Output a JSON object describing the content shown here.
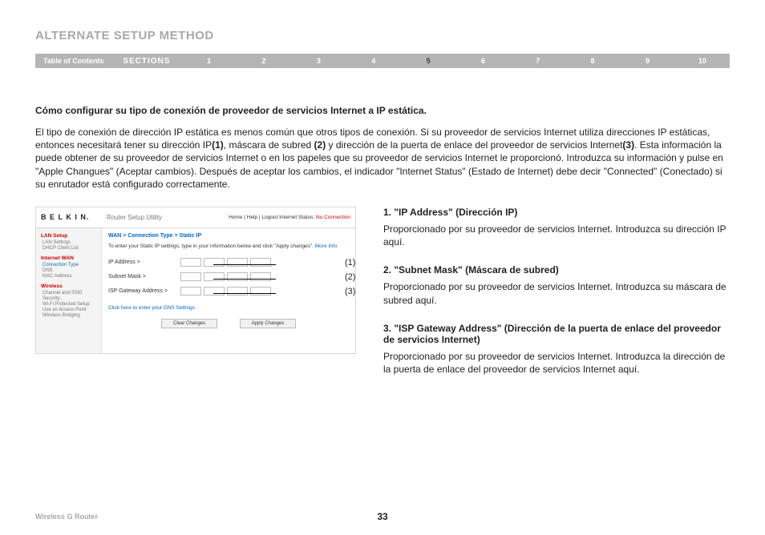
{
  "page": {
    "title": "ALTERNATE SETUP METHOD",
    "product": "Wireless G Router",
    "number": "33"
  },
  "nav": {
    "toc": "Table of Contents",
    "sections": "SECTIONS",
    "items": [
      "1",
      "2",
      "3",
      "4",
      "5",
      "6",
      "7",
      "8",
      "9",
      "10"
    ],
    "active": "5"
  },
  "intro": {
    "heading": "Cómo configurar su tipo de conexión de proveedor de servicios Internet a IP estática.",
    "paragraph_pre": "El tipo de conexión de dirección IP estática es menos común que otros tipos de conexión. Si su proveedor de servicios Internet utiliza direcciones IP estáticas, entonces necesitará tener su dirección IP",
    "m1": "(1)",
    "paragraph_mid1": ", máscara de subred ",
    "m2": "(2)",
    "paragraph_mid2": " y dirección de la puerta de enlace del proveedor de servicios Internet",
    "m3": "(3)",
    "paragraph_post": ". Esta información la puede obtener de su proveedor de servicios Internet o en los papeles que su proveedor de servicios Internet le proporcionó. Introduzca su información y pulse en \"Apple Changues\" (Aceptar cambios). Después de aceptar los cambios, el indicador \"Internet Status\" (Estado de Internet) debe decir \"Connected\" (Conectado) si su enrutador está configurado correctamente."
  },
  "screenshot": {
    "logo": "B E L K I N.",
    "utility": "Router Setup Utility",
    "links": "Home | Help | Logout   Internet Status: ",
    "status": "No Connection",
    "crumb": "WAN > Connection Type > Static IP",
    "note_pre": "To enter your Static IP settings, type in your information below and click \"Apply changes\". ",
    "note_more": "More Info",
    "rows": {
      "ip": "IP Address >",
      "subnet": "Subnet Mask >",
      "gateway": "ISP Gateway Address >"
    },
    "dns": "Click here to enter your DNS Settings",
    "buttons": {
      "clear": "Clear Changes",
      "apply": "Apply Changes"
    },
    "sidebar": {
      "lan_hdr": "LAN Setup",
      "lan1": "LAN Settings",
      "lan2": "DHCP Client List",
      "wan_hdr": "Internet WAN",
      "wan1": "Connection Type",
      "wan2": "DNS",
      "wan3": "MAC Address",
      "wl_hdr": "Wireless",
      "wl1": "Channel and SSID",
      "wl2": "Security",
      "wl3": "Wi-Fi Protected Setup",
      "wl4": "Use as Access Point",
      "wl5": "Wireless Bridging"
    },
    "callouts": {
      "c1": "(1)",
      "c2": "(2)",
      "c3": "(3)"
    }
  },
  "definitions": [
    {
      "head": "1.    \"IP Address\" (Dirección IP)",
      "text": "Proporcionado por su proveedor de servicios Internet. Introduzca su dirección IP aquí."
    },
    {
      "head": "2.    \"Subnet Mask\" (Máscara de subred)",
      "text": "Proporcionado por su proveedor de servicios Internet. Introduzca su máscara de subred aquí."
    },
    {
      "head": "3.    \"ISP Gateway Address\" (Dirección de la puerta de enlace del proveedor de servicios Internet)",
      "text": "Proporcionado por su proveedor de servicios Internet. Introduzca la dirección de la puerta de enlace del proveedor de servicios Internet aquí."
    }
  ]
}
